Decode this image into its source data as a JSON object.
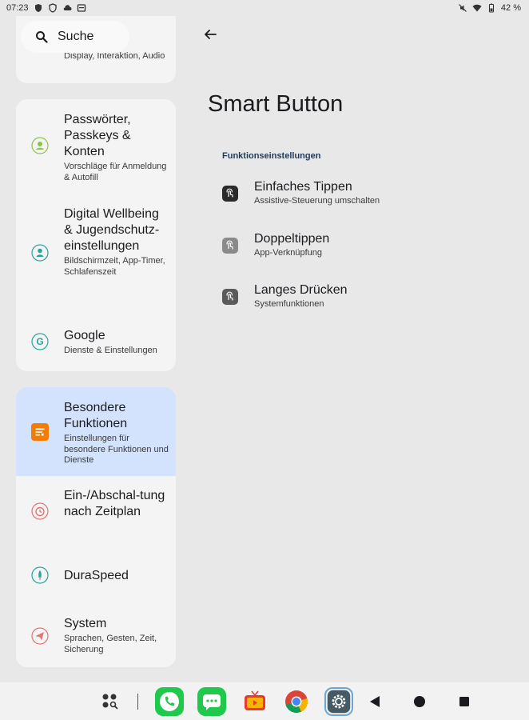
{
  "status_bar": {
    "time": "07:23",
    "battery": "42 %",
    "left_icons": [
      "shield-icon",
      "shield-outline-icon",
      "cloud-icon",
      "calendar-icon"
    ],
    "right_icons": [
      "mute-icon",
      "wifi-icon",
      "battery-icon"
    ]
  },
  "search": {
    "label": "Suche"
  },
  "sidebar": {
    "partial_item": {
      "subtitle": "Display, Interaktion, Audio"
    },
    "items": [
      {
        "title": "Passwörter, Passkeys & Konten",
        "subtitle": "Vorschläge für Anmeldung & Autofill",
        "icon": "account-icon"
      },
      {
        "title": "Digital Wellbeing & Jugendschutz-einstellungen",
        "subtitle": "Bildschirmzeit, App-Timer, Schlafenszeit",
        "icon": "wellbeing-icon"
      },
      {
        "title": "Google",
        "subtitle": "Dienste & Einstellungen",
        "icon": "google-icon"
      },
      {
        "title": "Besondere Funktionen",
        "subtitle": "Einstellungen für besondere Funktionen und Dienste",
        "icon": "features-icon",
        "active": true
      },
      {
        "title": "Ein-/Abschal-tung nach Zeitplan",
        "subtitle": "",
        "icon": "alarm-icon"
      },
      {
        "title": "DuraSpeed",
        "subtitle": "",
        "icon": "rocket-icon"
      },
      {
        "title": "System",
        "subtitle": "Sprachen, Gesten, Zeit, Sicherung",
        "icon": "send-icon"
      }
    ]
  },
  "main": {
    "title": "Smart Button",
    "section": "Funktionseinstellungen",
    "rows": [
      {
        "title": "Einfaches Tippen",
        "subtitle": "Assistive-Steuerung umschalten",
        "icon": "single-tap-icon"
      },
      {
        "title": "Doppeltippen",
        "subtitle": "App-Verknüpfung",
        "icon": "double-tap-icon"
      },
      {
        "title": "Langes Drücken",
        "subtitle": "Systemfunktionen",
        "icon": "long-press-icon"
      }
    ]
  },
  "dock": {
    "apps": [
      "app-drawer-icon",
      "phone-icon",
      "messages-icon",
      "tv-icon",
      "chrome-icon",
      "settings-icon"
    ],
    "nav": [
      "back-icon",
      "home-icon",
      "recents-icon"
    ]
  },
  "colors": {
    "background": "#e8e8e8",
    "card": "#f4f4f4",
    "active_item": "#d3e3fd",
    "accent_orange": "#f57c00",
    "section_header": "#1d3a5c"
  }
}
